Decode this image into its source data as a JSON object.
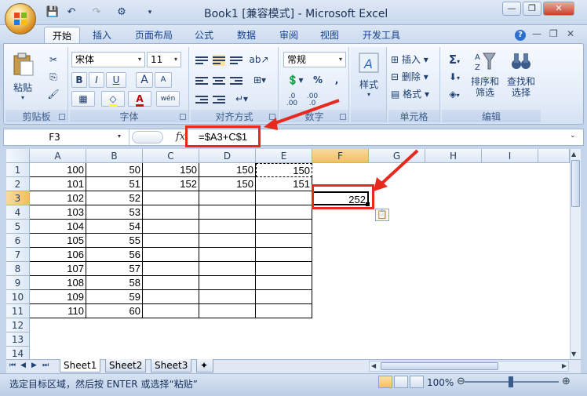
{
  "window": {
    "title": "Book1  [兼容模式] - Microsoft Excel",
    "controls": [
      "—",
      "❐",
      "✕"
    ]
  },
  "ribbon": {
    "tabs": [
      "开始",
      "插入",
      "页面布局",
      "公式",
      "数据",
      "审阅",
      "视图",
      "开发工具"
    ],
    "active_tab": "开始",
    "groups": {
      "clipboard": {
        "label": "剪贴板",
        "paste": "粘贴"
      },
      "font": {
        "label": "字体",
        "font_name": "宋体",
        "font_size": "11",
        "bold": "B",
        "italic": "I",
        "underline": "U",
        "grow": "A",
        "shrink": "A",
        "phonetic": "wén",
        "font_color_letter": "A"
      },
      "alignment": {
        "label": "对齐方式"
      },
      "number": {
        "label": "数字",
        "format": "常规",
        "percent": "%",
        "comma": ",",
        "inc_decimal": ".0\n.00",
        "dec_decimal": ".00\n.0"
      },
      "styles": {
        "label": "样式",
        "styles_button": "样式"
      },
      "cells": {
        "label": "单元格",
        "insert": "插入",
        "delete": "删除",
        "format": "格式"
      },
      "editing": {
        "label": "编辑",
        "sum": "Σ",
        "sort_filter": "排序和\n筛选",
        "find_select": "查找和\n选择"
      }
    }
  },
  "formula_bar": {
    "name_box": "F3",
    "fx": "fx",
    "formula": "=$A3+C$1"
  },
  "grid": {
    "columns": [
      "A",
      "B",
      "C",
      "D",
      "E",
      "F",
      "G",
      "H",
      "I"
    ],
    "selected_column": "F",
    "rows": [
      "1",
      "2",
      "3",
      "4",
      "5",
      "6",
      "7",
      "8",
      "9",
      "10",
      "11",
      "12",
      "13",
      "14"
    ],
    "selected_row": "3",
    "values": {
      "A": [
        "100",
        "101",
        "102",
        "103",
        "104",
        "105",
        "106",
        "107",
        "108",
        "109",
        "110"
      ],
      "B": [
        "50",
        "51",
        "52",
        "53",
        "54",
        "55",
        "56",
        "57",
        "58",
        "59",
        "60"
      ],
      "C1": "150",
      "D1": "150",
      "E1": "150",
      "C2": "152",
      "D2": "150",
      "E2": "151",
      "F3": "252"
    }
  },
  "sheets": {
    "tabs": [
      "Sheet1",
      "Sheet2",
      "Sheet3"
    ],
    "active": "Sheet1"
  },
  "status_bar": {
    "message": "选定目标区域，然后按 ENTER 或选择“粘贴”",
    "zoom": "100%"
  },
  "colors": {
    "annotation": "#e8291d",
    "selected_header": "#f1c15f",
    "ribbon_text": "#1e3f72"
  }
}
